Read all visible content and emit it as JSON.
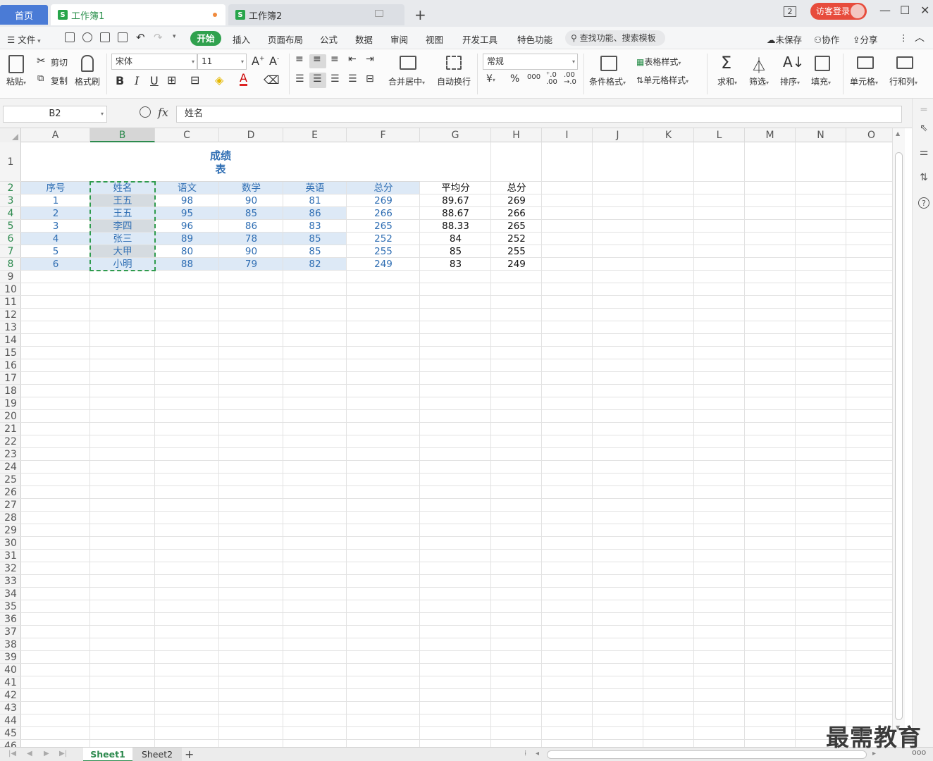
{
  "tabs": {
    "home": "首页",
    "workbook1": "工作簿1",
    "workbook2": "工作簿2",
    "logo": "S",
    "new_tab": "+"
  },
  "titlebar": {
    "window_count": "2",
    "login": "访客登录",
    "controls": [
      "—",
      "☐",
      "✕"
    ]
  },
  "menu": {
    "file": "文件",
    "start": "开始",
    "items": [
      "插入",
      "页面布局",
      "公式",
      "数据",
      "审阅",
      "视图",
      "开发工具",
      "特色功能"
    ],
    "search_placeholder": "查找功能、搜索模板",
    "unsaved": "未保存",
    "collaborate": "协作",
    "share": "分享"
  },
  "ribbon": {
    "paste": "粘贴",
    "cut": "剪切",
    "copy": "复制",
    "format_painter": "格式刷",
    "font_name": "宋体",
    "font_size": "11",
    "bold": "B",
    "italic": "I",
    "underline": "U",
    "merge_center": "合并居中",
    "wrap_text": "自动换行",
    "number_format": "常规",
    "currency": "¥",
    "percent": "%",
    "thousands": "000",
    "conditional_format": "条件格式",
    "table_style": "表格样式",
    "cell_style": "单元格样式",
    "sum": "求和",
    "filter": "筛选",
    "sort": "排序",
    "fill": "填充",
    "cell": "单元格",
    "row_col": "行和列"
  },
  "formula_bar": {
    "name_box": "B2",
    "fx": "fx",
    "content": "姓名"
  },
  "grid": {
    "columns": [
      "A",
      "B",
      "C",
      "D",
      "E",
      "F",
      "G",
      "H",
      "I",
      "J",
      "K",
      "L",
      "M",
      "N",
      "O"
    ],
    "selected_column": "B",
    "title": "成绩表",
    "headers": [
      "序号",
      "姓名",
      "语文",
      "数学",
      "英语",
      "总分",
      "平均分",
      "总分"
    ],
    "rows": [
      [
        "1",
        "王五",
        "98",
        "90",
        "81",
        "269",
        "89.67",
        "269"
      ],
      [
        "2",
        "王五",
        "95",
        "85",
        "86",
        "266",
        "88.67",
        "266"
      ],
      [
        "3",
        "李四",
        "96",
        "86",
        "83",
        "265",
        "88.33",
        "265"
      ],
      [
        "4",
        "张三",
        "89",
        "78",
        "85",
        "252",
        "84",
        "252"
      ],
      [
        "5",
        "大甲",
        "80",
        "90",
        "85",
        "255",
        "85",
        "255"
      ],
      [
        "6",
        "小明",
        "88",
        "79",
        "82",
        "249",
        "83",
        "249"
      ]
    ],
    "row_count": 46
  },
  "sheets": {
    "sheet1": "Sheet1",
    "sheet2": "Sheet2",
    "add": "+"
  },
  "watermark": "最需教育",
  "colors": {
    "accent_green": "#30a14e",
    "data_blue": "#2f6eb3",
    "highlight": "#dde9f6",
    "login_red": "#e74c3c"
  }
}
